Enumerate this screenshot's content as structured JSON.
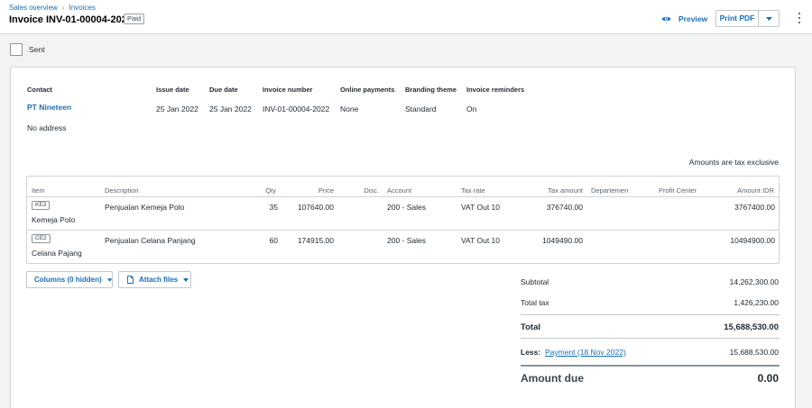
{
  "breadcrumb": {
    "parent": "Sales overview",
    "current": "Invoices",
    "separator": "›"
  },
  "page_title": "Invoice INV-01-00004-2022",
  "status_badge": "Paid",
  "actions": {
    "preview": "Preview",
    "print_pdf": "Print PDF"
  },
  "sent_label": "Sent",
  "details": {
    "contact_header": "Contact",
    "contact_name": "PT Nineteen",
    "address": "No address",
    "issue_date_header": "Issue date",
    "issue_date": "25 Jan 2022",
    "due_date_header": "Due date",
    "due_date": "25 Jan 2022",
    "invoice_number_header": "Invoice number",
    "invoice_number": "INV-01-00004-2022",
    "online_payments_header": "Online payments",
    "online_payments": "None",
    "branding_theme_header": "Branding theme",
    "branding_theme": "Standard",
    "invoice_reminders_header": "Invoice reminders",
    "invoice_reminders": "On"
  },
  "amounts_note": "Amounts are tax exclusive",
  "table": {
    "headers": {
      "item": "Item",
      "description": "Description",
      "qty": "Qty",
      "price": "Price",
      "disc": "Disc.",
      "account": "Account",
      "tax_rate": "Tax rate",
      "tax_amount": "Tax amount",
      "departemen": "Departemen",
      "profit_center": "Profit Center",
      "amount": "Amount IDR"
    },
    "rows": [
      {
        "code": "KE3",
        "item": "Kemeja Polo",
        "description": "Penjualan Kemeja Polo",
        "qty": "35",
        "price": "107640.00",
        "disc": "",
        "account": "200 - Sales",
        "tax_rate": "VAT Out 10",
        "tax_amount": "376740.00",
        "departemen": "",
        "profit_center": "",
        "amount": "3767400.00"
      },
      {
        "code": "CE2",
        "item": "Celana Pajang",
        "description": "Penjualan Celana Panjang",
        "qty": "60",
        "price": "174915.00",
        "disc": "",
        "account": "200 - Sales",
        "tax_rate": "VAT Out 10",
        "tax_amount": "1049490.00",
        "departemen": "",
        "profit_center": "",
        "amount": "10494900.00"
      }
    ]
  },
  "buttons": {
    "columns": "Columns (0 hidden)",
    "attach": "Attach files"
  },
  "totals": {
    "subtotal_label": "Subtotal",
    "subtotal": "14,262,300.00",
    "total_tax_label": "Total tax",
    "total_tax": "1,426,230.00",
    "total_label": "Total",
    "total": "15,688,530.00",
    "less_label": "Less:",
    "payment_link": "Payment (18 Nov 2022)",
    "payment": "15,688,530.00",
    "amount_due_label": "Amount due",
    "amount_due": "0.00"
  },
  "colors": {
    "link_blue": "#1a6fb5",
    "text": "#1e2a33",
    "border": "#cfd4d8"
  },
  "icons": {
    "preview": "eye-icon",
    "dropdown": "caret-down-icon",
    "attach": "document-icon",
    "more": "kebab-icon"
  }
}
